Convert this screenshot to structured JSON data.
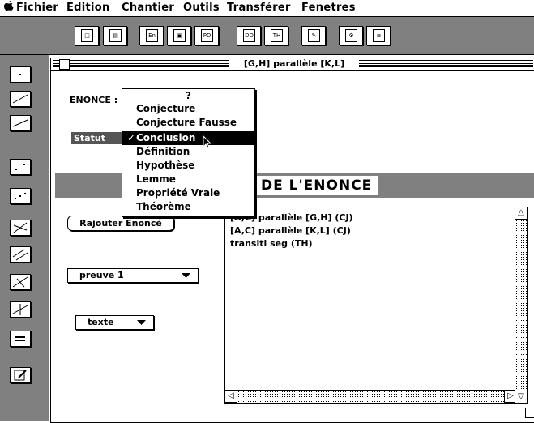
{
  "menubar": {
    "apple_icon": "apple-logo",
    "items": [
      "Fichier",
      "Edition",
      "Chantier",
      "Outils",
      "Transférer",
      "Fenetres"
    ]
  },
  "window": {
    "title": "[G,H] parallèle [K,L]"
  },
  "form": {
    "enonce_label": "ENONCE :",
    "statut_label": "Statut"
  },
  "popup": {
    "items": [
      "?",
      "Conjecture",
      "Conjecture Fausse",
      "Conclusion",
      "Définition",
      "Hypothèse",
      "Lemme",
      "Propriété Vraie",
      "Théorème"
    ],
    "selected": "Conclusion",
    "checkmark": "✓"
  },
  "section_header": "DE  L'ENONCE",
  "buttons": {
    "rajouter": "Rajouter Enoncé",
    "preuve": "preuve 1",
    "texte": "texte"
  },
  "list": {
    "lines": [
      "[A,C] parallèle [G,H]  (CJ)",
      "[A,C] parallèle [K,L]  (CJ)",
      "transiti seg  (TH)"
    ]
  },
  "toolbar": {
    "icons": [
      "new-doc-icon",
      "trash-icon",
      "en-icon",
      "screen-icon",
      "pd-icon",
      "dd-icon",
      "th-icon",
      "edit-icon",
      "tools-icon",
      "text-icon"
    ]
  }
}
